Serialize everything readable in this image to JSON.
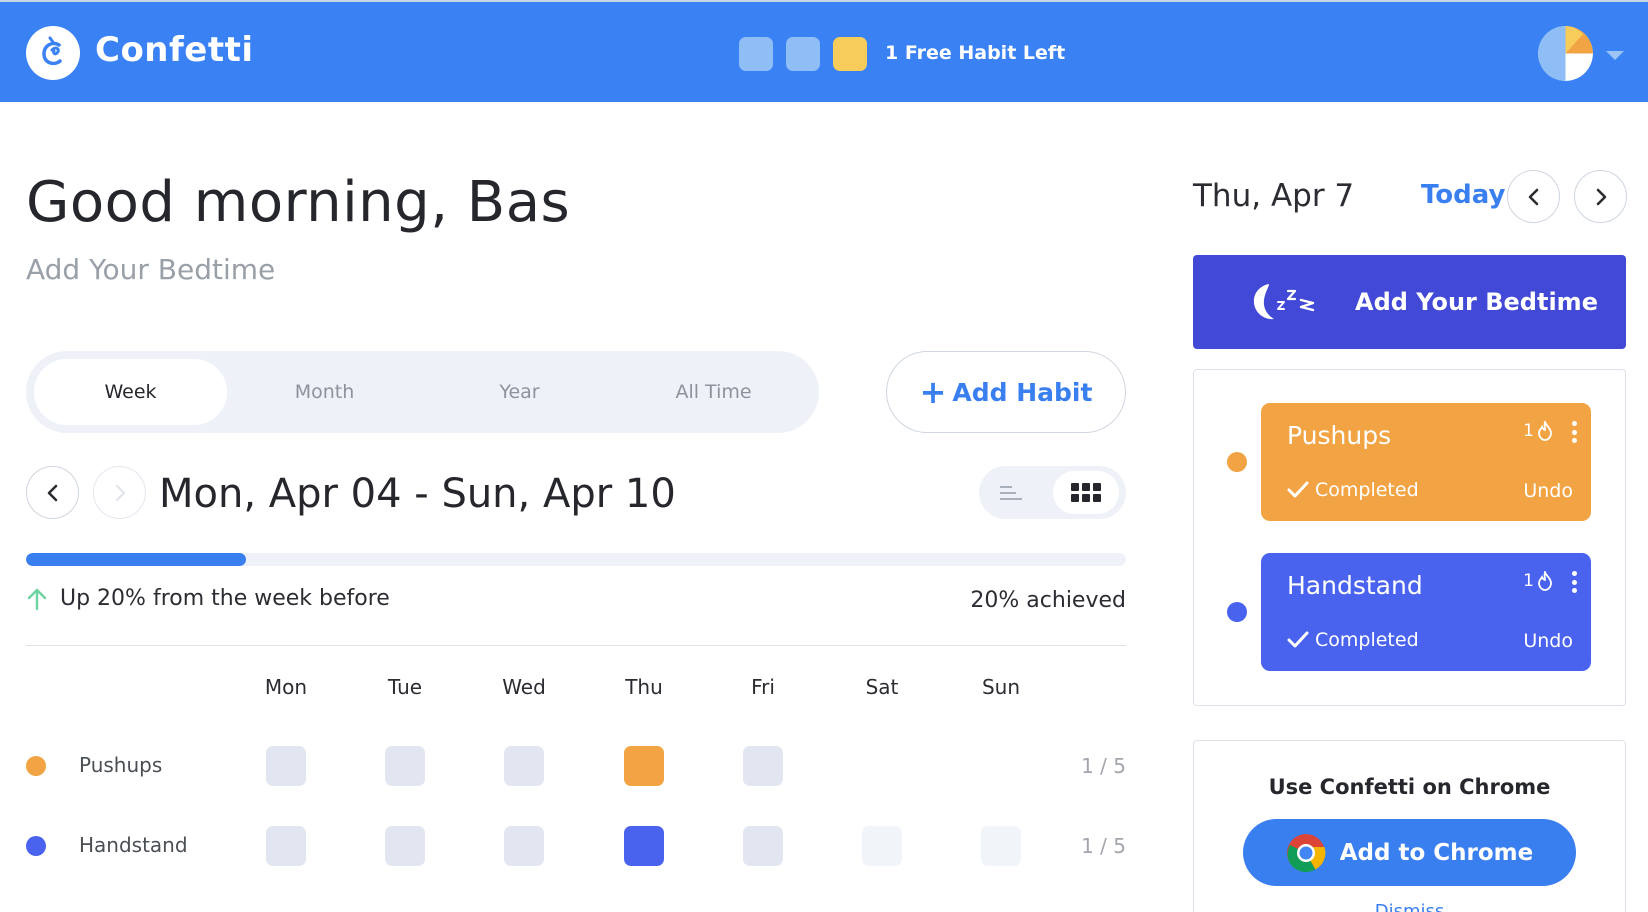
{
  "header": {
    "brand": "Confetti",
    "free_habits_text": "1 Free Habit Left",
    "habit_slot_colors": [
      "#8fbef7",
      "#8fbef7",
      "#f7cc5a"
    ],
    "logo_icon": "confetti-logo",
    "avatar_icon": "user-avatar",
    "menu_icon": "chevron-down-icon"
  },
  "main": {
    "greeting": "Good morning, Bas",
    "subtitle": "Add Your Bedtime",
    "tabs": [
      {
        "label": "Week",
        "active": true
      },
      {
        "label": "Month",
        "active": false
      },
      {
        "label": "Year",
        "active": false
      },
      {
        "label": "All Time",
        "active": false
      }
    ],
    "add_habit_label": "Add Habit",
    "week_range": "Mon, Apr 04 - Sun, Apr 10",
    "progress_fraction": 0.2,
    "trend_text": "Up 20% from the week before",
    "achieved_text": "20% achieved",
    "days": [
      "Mon",
      "Tue",
      "Wed",
      "Thu",
      "Fri",
      "Sat",
      "Sun"
    ],
    "habits": [
      {
        "name": "Pushups",
        "color": "#f2a444",
        "cells": [
          "empty",
          "empty",
          "empty",
          "done",
          "empty",
          "none",
          "none"
        ],
        "count": "1 / 5"
      },
      {
        "name": "Handstand",
        "color": "#4a63ee",
        "cells": [
          "empty",
          "empty",
          "empty",
          "done",
          "empty",
          "light",
          "light"
        ],
        "count": "1 / 5"
      }
    ]
  },
  "sidebar": {
    "date": "Thu, Apr 7",
    "today_label": "Today",
    "bedtime_label": "Add Your Bedtime",
    "bedtime_color": "#4149d6",
    "cards": [
      {
        "name": "Pushups",
        "streak": "1",
        "status": "Completed",
        "undo": "Undo",
        "color": "#f2a444"
      },
      {
        "name": "Handstand",
        "streak": "1",
        "status": "Completed",
        "undo": "Undo",
        "color": "#4a63ee"
      }
    ],
    "chrome": {
      "title": "Use Confetti on Chrome",
      "button": "Add to Chrome",
      "dismiss": "Dismiss"
    }
  },
  "colors": {
    "accent": "#3a82f3",
    "link": "#3a7ff0",
    "trend_up": "#6dd3a0"
  }
}
